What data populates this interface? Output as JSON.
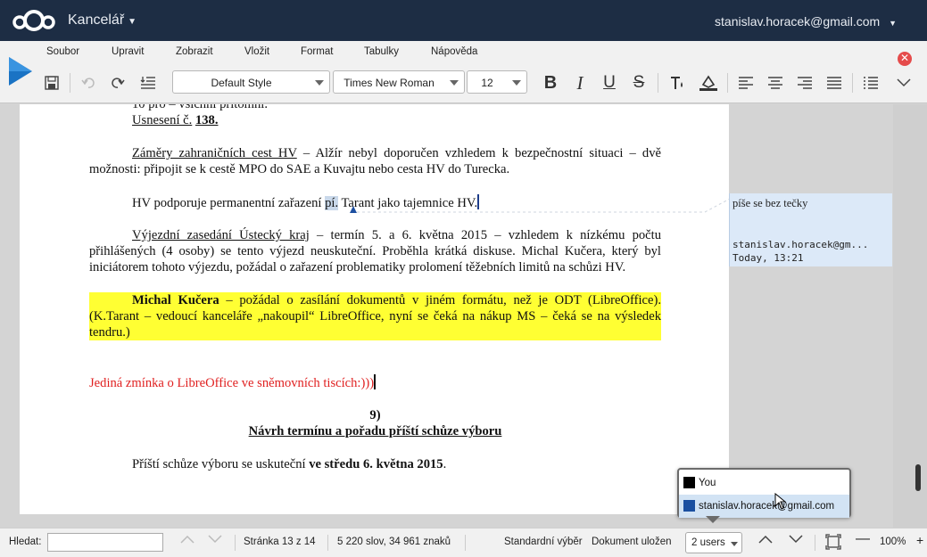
{
  "header": {
    "app_name": "Kancelář",
    "user_email": "stanislav.horacek@gmail.com"
  },
  "menu": [
    "Soubor",
    "Upravit",
    "Zobrazit",
    "Vložit",
    "Format",
    "Tabulky",
    "Nápověda"
  ],
  "toolbar": {
    "paragraph_style": "Default Style",
    "font_name": "Times New Roman",
    "font_size": "12",
    "icons": [
      "save-icon",
      "undo-icon",
      "redo-icon",
      "format-paintbrush-icon",
      "bold-icon",
      "italic-icon",
      "underline-icon",
      "strikethrough-icon",
      "text-color-icon",
      "highlight-color-icon",
      "align-left-icon",
      "align-center-icon",
      "align-right-icon",
      "justify-icon",
      "list-icon",
      "more-icon"
    ]
  },
  "document": {
    "line1": "10 pro – všichni přítomni.",
    "resolution": "Usnesení č.",
    "resolution_num": "138.",
    "p1_lead": "Záměry zahraničních cest HV",
    "p1_rest": " – Alžír nebyl doporučen vzhledem k bezpečnostní situaci – dvě možnosti: připojit se k cestě MPO do SAE a Kuvajtu nebo cesta HV do Turecka.",
    "p2_a": "HV podporuje permanentní zařazení ",
    "p2_sel": "pí.",
    "p2_b": " Tarant jako tajemnice HV.",
    "p3_lead": "Výjezdní zasedání Ústecký kraj",
    "p3_rest": " – termín 5. a 6. května 2015 – vzhledem k nízkému počtu přihlášených (4 osoby) se tento výjezd neuskuteční. Proběhla krátká diskuse. Michal Kučera, který byl iniciátorem tohoto výjezdu, požádal o zařazení problematiky prolomení těžebních limitů na schůzi HV.",
    "p4_name": "Michal Kučera",
    "p4_rest": " – požádal o zasílání dokumentů v jiném formátu, než je ODT (LibreOffice). (K.Tarant – vedoucí kanceláře „nakoupil“ LibreOffice, nyní se čeká na nákup MS – čeká se na výsledek tendru.)",
    "p5": "Jediná zmínka o LibreOffice ve sněmovních tiscích:)))",
    "section_num": "9)",
    "section_title": "Návrh termínu a pořadu příští schůze výboru",
    "p6_a": "Příští schůze výboru se uskuteční ",
    "p6_b": "ve středu 6. května 2015",
    "p6_c": "."
  },
  "comment": {
    "text": "píše se bez tečky",
    "author": "stanislav.horacek@gm...",
    "time": "Today, 13:21"
  },
  "statusbar": {
    "search_label": "Hledat:",
    "page": "Stránka 13 z 14",
    "words": "5 220 slov, 34 961 znaků",
    "selection_mode": "Standardní výběr",
    "doc_status": "Dokument uložen",
    "users": "2 users",
    "zoom": "100%"
  },
  "users_popup": [
    {
      "name": "You",
      "color": "#000000"
    },
    {
      "name": "stanislav.horacek@gmail.com",
      "color": "#1a4fa0"
    }
  ],
  "colors": {
    "header_bg": "#1d2d44",
    "highlight": "#ffff33",
    "red_text": "#e02020",
    "comment_bg": "#dce9f8",
    "close": "#e54b4b"
  }
}
